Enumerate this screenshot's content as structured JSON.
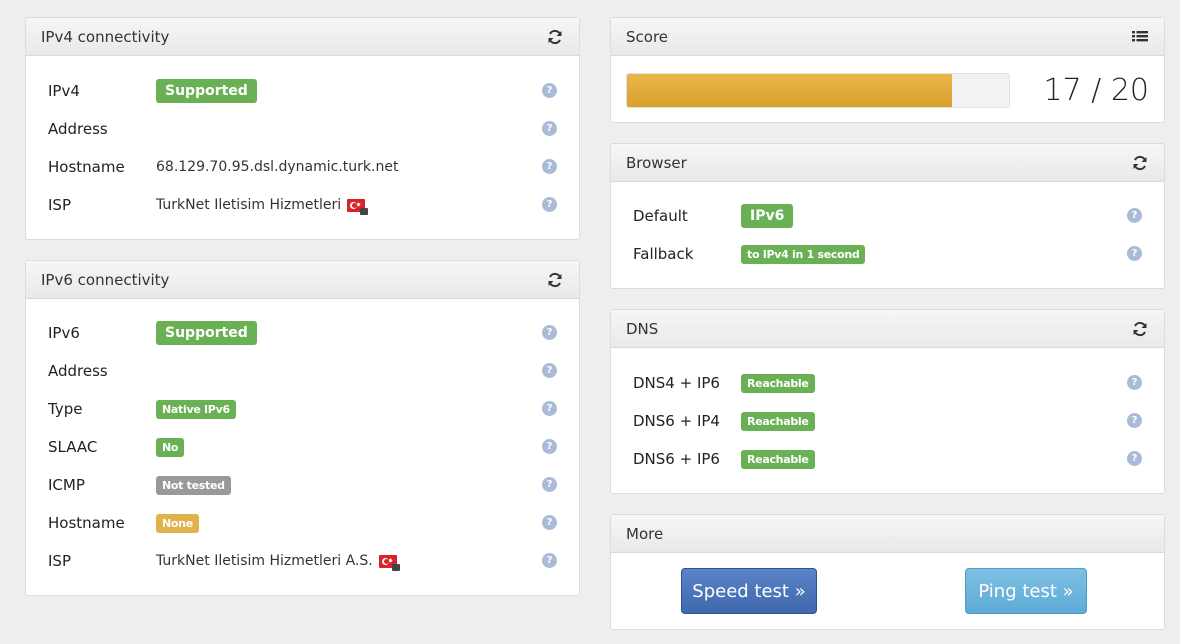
{
  "ipv4": {
    "title": "IPv4 connectivity",
    "rows": [
      {
        "label": "IPv4",
        "badge": "Supported"
      },
      {
        "label": "Address",
        "value": ""
      },
      {
        "label": "Hostname",
        "value": "68.129.70.95.dsl.dynamic.turk.net"
      },
      {
        "label": "ISP",
        "value": "TurkNet Iletisim Hizmetleri"
      }
    ]
  },
  "ipv6": {
    "title": "IPv6 connectivity",
    "rows": [
      {
        "label": "IPv6",
        "badge": "Supported"
      },
      {
        "label": "Address",
        "value": ""
      },
      {
        "label": "Type",
        "badge": "Native IPv6"
      },
      {
        "label": "SLAAC",
        "badge": "No"
      },
      {
        "label": "ICMP",
        "badge": "Not tested"
      },
      {
        "label": "Hostname",
        "badge": "None"
      },
      {
        "label": "ISP",
        "value": "TurkNet Iletisim Hizmetleri A.S."
      }
    ]
  },
  "score": {
    "title": "Score",
    "text": "17 / 20",
    "fraction": 0.85
  },
  "browser": {
    "title": "Browser",
    "rows": [
      {
        "label": "Default",
        "badge": "IPv6"
      },
      {
        "label": "Fallback",
        "badge": "to IPv4 in 1 second"
      }
    ]
  },
  "dns": {
    "title": "DNS",
    "rows": [
      {
        "label": "DNS4 + IP6",
        "badge": "Reachable"
      },
      {
        "label": "DNS6 + IP4",
        "badge": "Reachable"
      },
      {
        "label": "DNS6 + IP6",
        "badge": "Reachable"
      }
    ]
  },
  "more": {
    "title": "More",
    "speed_label": "Speed test »",
    "ping_label": "Ping test »"
  },
  "help_glyph": "?",
  "icons": {
    "refresh": "refresh-icon",
    "list": "list-icon",
    "help": "help-icon",
    "flag": "turkey-flag-icon"
  },
  "colors": {
    "success": "#6ab155",
    "default": "#999999",
    "warning": "#e0b24a",
    "progress": "#e0a93a",
    "primary": "#4a74b8",
    "info": "#6bb5dd"
  }
}
